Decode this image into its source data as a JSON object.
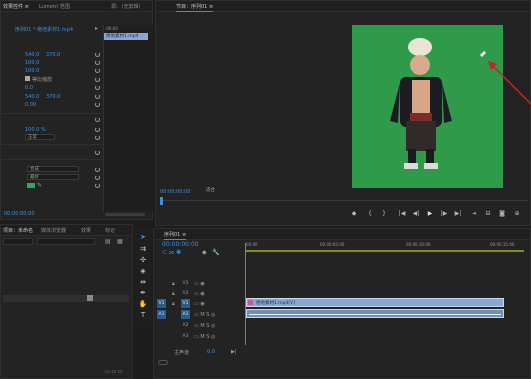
{
  "effects_panel": {
    "tabs": [
      "效果控件 ≡",
      "Lumetri 范围",
      "源：（无剪辑）",
      "音频剪辑混合器：序列01"
    ],
    "breadcrumb": "序列01 * 绝地素材1.mp4",
    "clip_label": "绝地素材1.mp4",
    "rows": [
      {
        "label": "",
        "v1": "540.0",
        "v2": "370.0"
      },
      {
        "label": "",
        "v1": "100.0",
        "v2": ""
      },
      {
        "label": "",
        "v1": "100.0",
        "v2": ""
      },
      {
        "label": "等比缩放",
        "v1": "",
        "v2": ""
      },
      {
        "label": "",
        "v1": "0.0",
        "v2": ""
      },
      {
        "label": "",
        "v1": "540.0",
        "v2": "370.0"
      },
      {
        "label": "",
        "v1": "0.00",
        "v2": ""
      },
      {
        "label": "",
        "v1": "100.0 %",
        "v2": ""
      },
      {
        "label": "",
        "v1": "正常",
        "v2": ""
      }
    ],
    "dropdowns": [
      "合成",
      "最好"
    ],
    "mini_timecode": "00:00:00:00"
  },
  "program_monitor": {
    "title": "节目：序列01 ≡",
    "timecode": "00:00:00:00",
    "fit": "适合",
    "buttons": [
      "◆",
      "{",
      "}",
      "|◀",
      "◀|",
      "▶",
      "|▶",
      "▶|",
      "⇥",
      "⊟",
      "⊞",
      "◙",
      "⊕"
    ]
  },
  "project_panel": {
    "tabs": [
      "项目：未命名",
      "媒体浏览器",
      "效果",
      "标记"
    ],
    "search_placeholder": ""
  },
  "timeline": {
    "title": "序列01 ≡",
    "timecode": "00:00:00:00",
    "ruler": [
      "00:00",
      "00:00:05:00",
      "00:00:10:00",
      "00:00:15:00"
    ],
    "tracks": [
      {
        "id": "V3",
        "on": false
      },
      {
        "id": "V2",
        "on": false
      },
      {
        "id": "V1",
        "on": true
      },
      {
        "id": "A1",
        "on": true
      },
      {
        "id": "A2",
        "on": false
      },
      {
        "id": "A3",
        "on": false
      }
    ],
    "master": "主声道",
    "master_value": "0.0",
    "clip_label": "绝地素材1.mp4[V]"
  },
  "colors": {
    "accent": "#3f8fe0",
    "clip_video": "#8aa6d2",
    "clip_audio": "#6f8fb6",
    "green_screen": "#2f9b4a",
    "work_area": "#8a8b1f",
    "arrow": "#cc2222"
  },
  "icons": [
    "selection-tool-icon",
    "track-select-icon",
    "ripple-edit-icon",
    "razor-icon",
    "slip-icon",
    "pen-icon",
    "hand-icon",
    "type-icon",
    "wrench-icon",
    "snap-icon",
    "marker-icon"
  ]
}
